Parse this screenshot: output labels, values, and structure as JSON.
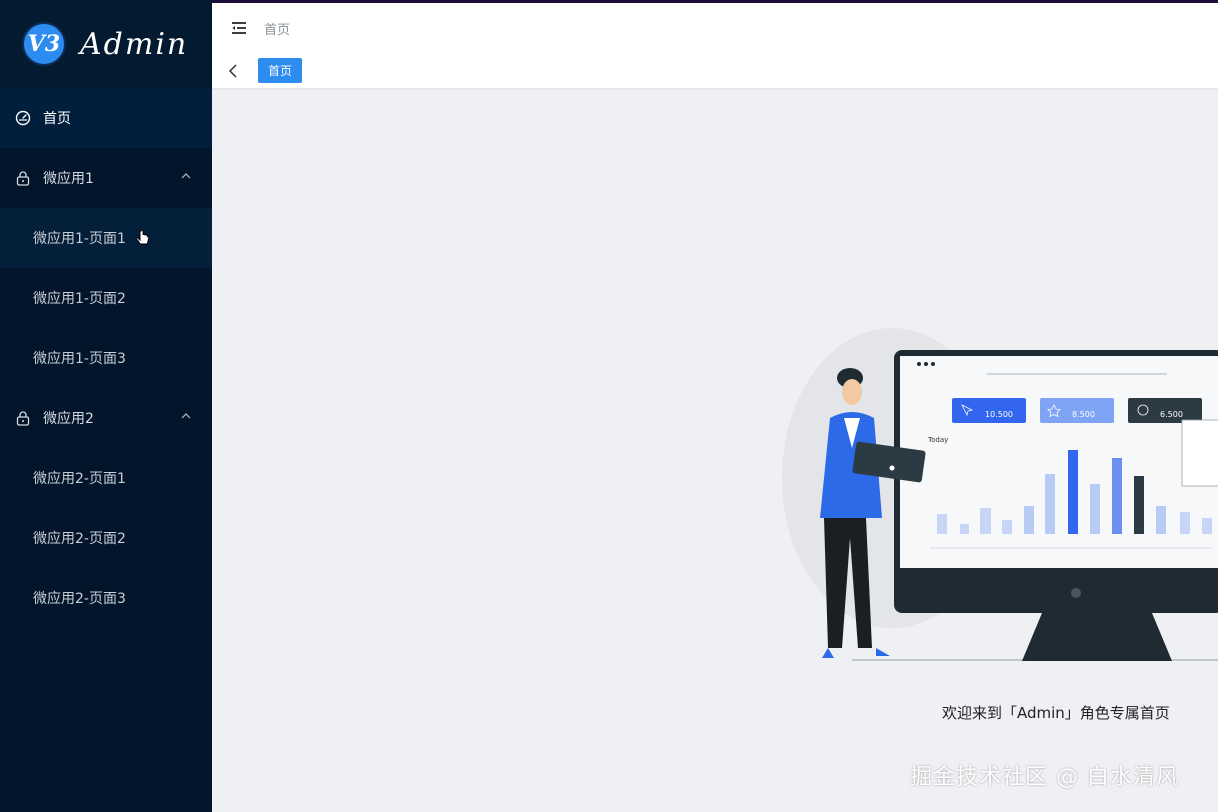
{
  "sidebar": {
    "logo_badge": "V3",
    "logo_text": "Admin",
    "home_label": "首页",
    "groups": [
      {
        "label": "微应用1",
        "items": [
          "微应用1-页面1",
          "微应用1-页面2",
          "微应用1-页面3"
        ]
      },
      {
        "label": "微应用2",
        "items": [
          "微应用2-页面1",
          "微应用2-页面2",
          "微应用2-页面3"
        ]
      }
    ]
  },
  "header": {
    "breadcrumb": "首页",
    "active_tag": "首页"
  },
  "main": {
    "welcome": "欢迎来到「Admin」角色专属首页",
    "watermark": "掘金技术社区 @ 白水清风",
    "dashboard": {
      "today": "Today",
      "stat1": "10.500",
      "stat2": "8.500",
      "stat3": "6.500"
    }
  },
  "colors": {
    "sidebar_bg": "#02152a",
    "accent": "#2d8cf0",
    "content_bg": "#eef0f3"
  }
}
